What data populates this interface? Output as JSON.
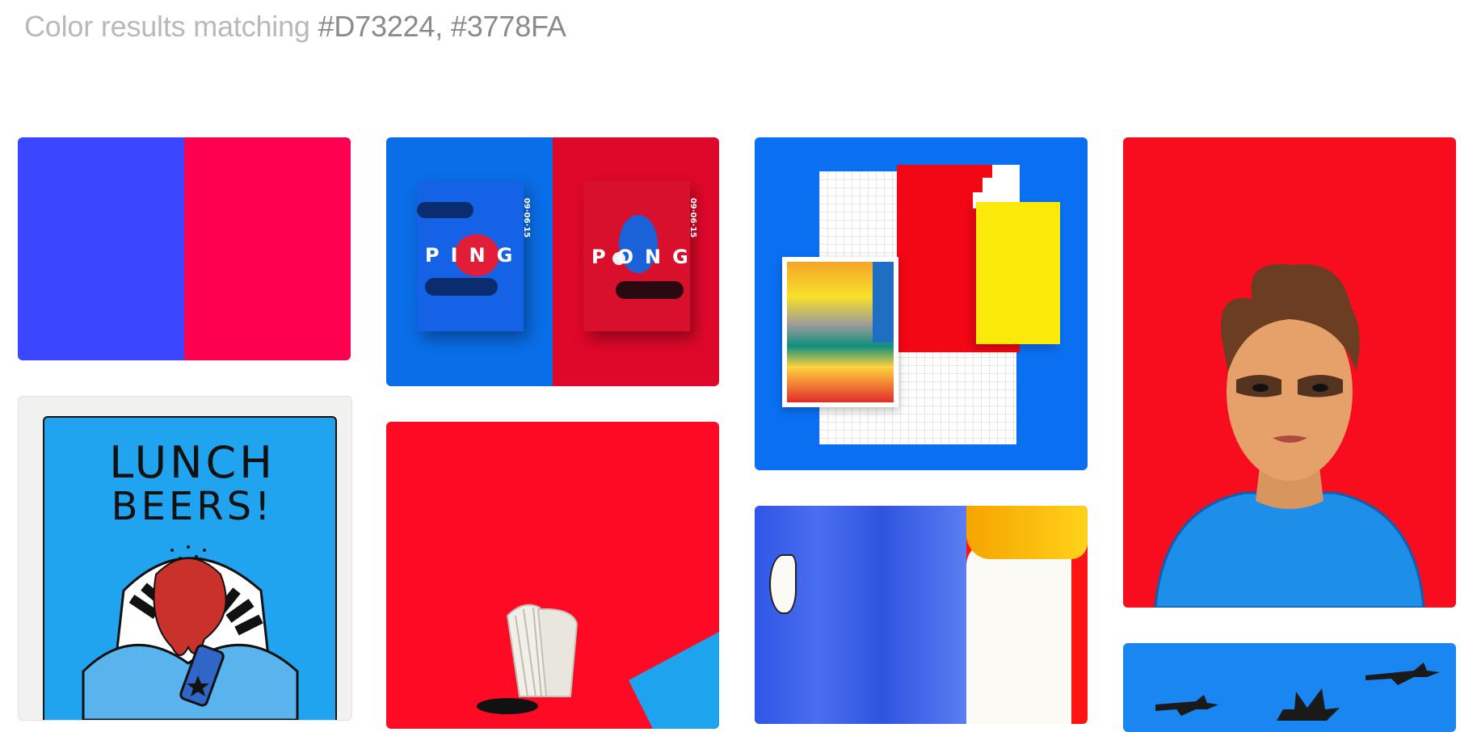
{
  "header": {
    "prefix": "Color results matching",
    "hex1": "#D73224",
    "separator": ", ",
    "hex2": "#3778FA"
  },
  "colors": {
    "accent_blue": "#3778FA",
    "accent_red": "#D73224",
    "swatch_blue": "#3A46FF",
    "swatch_pink": "#FF0050"
  },
  "cards": {
    "ping_pong": {
      "left_word": "PING",
      "right_word": "PONG",
      "date": "09·06·15",
      "small_left": "PONG",
      "small_right": "PING"
    },
    "lunch": {
      "line1": "LUNCH",
      "line2": "BEERS!"
    }
  }
}
